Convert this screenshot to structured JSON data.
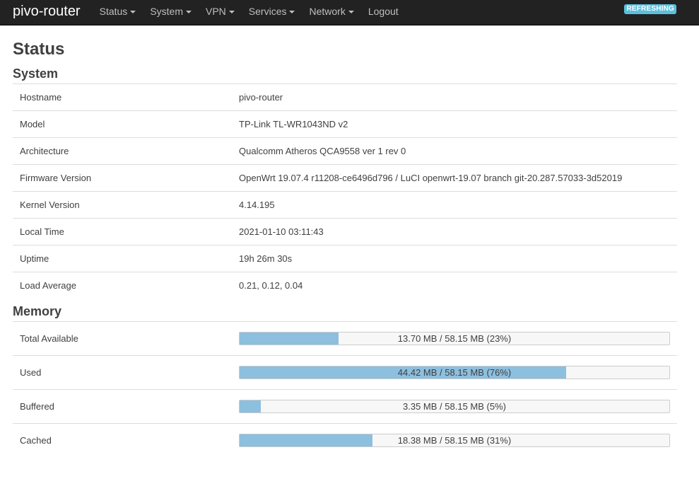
{
  "app": {
    "brand": "pivo-router",
    "refresh_badge": "REFRESHING"
  },
  "nav": {
    "items": [
      {
        "label": "Status",
        "dropdown": true
      },
      {
        "label": "System",
        "dropdown": true
      },
      {
        "label": "VPN",
        "dropdown": true
      },
      {
        "label": "Services",
        "dropdown": true
      },
      {
        "label": "Network",
        "dropdown": true
      },
      {
        "label": "Logout",
        "dropdown": false
      }
    ]
  },
  "page": {
    "title": "Status"
  },
  "system": {
    "title": "System",
    "rows": [
      {
        "key": "Hostname",
        "value": "pivo-router"
      },
      {
        "key": "Model",
        "value": "TP-Link TL-WR1043ND v2"
      },
      {
        "key": "Architecture",
        "value": "Qualcomm Atheros QCA9558 ver 1 rev 0"
      },
      {
        "key": "Firmware Version",
        "value": "OpenWrt 19.07.4 r11208-ce6496d796 / LuCI openwrt-19.07 branch git-20.287.57033-3d52019"
      },
      {
        "key": "Kernel Version",
        "value": "4.14.195"
      },
      {
        "key": "Local Time",
        "value": "2021-01-10 03:11:43"
      },
      {
        "key": "Uptime",
        "value": "19h 26m 30s"
      },
      {
        "key": "Load Average",
        "value": "0.21, 0.12, 0.04"
      }
    ]
  },
  "memory": {
    "title": "Memory",
    "rows": [
      {
        "key": "Total Available",
        "text": "13.70 MB / 58.15 MB (23%)",
        "percent": 23
      },
      {
        "key": "Used",
        "text": "44.42 MB / 58.15 MB (76%)",
        "percent": 76
      },
      {
        "key": "Buffered",
        "text": "3.35 MB / 58.15 MB (5%)",
        "percent": 5
      },
      {
        "key": "Cached",
        "text": "18.38 MB / 58.15 MB (31%)",
        "percent": 31
      }
    ]
  },
  "colors": {
    "navbar_bg": "#222222",
    "bar_fill": "#8dbfdf",
    "badge_bg": "#5bc0de"
  }
}
